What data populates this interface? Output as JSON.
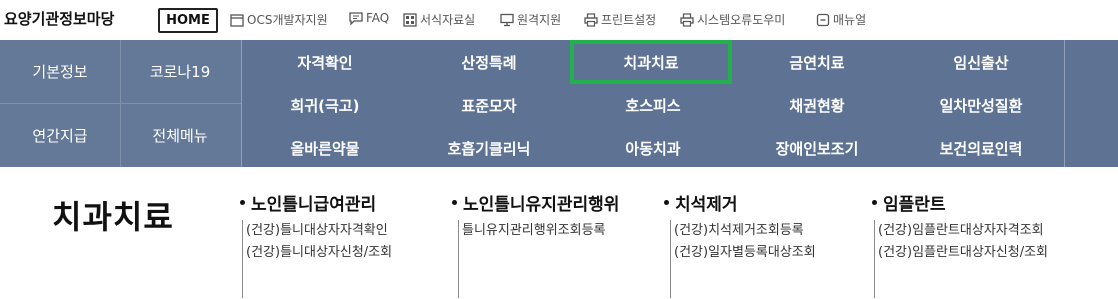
{
  "header": {
    "site_title": "요양기관정보마당",
    "home_label": "HOME",
    "utilities": [
      {
        "label": "OCS개발자지원",
        "icon": "calendar-icon"
      },
      {
        "label": "FAQ",
        "icon": "chat-icon"
      },
      {
        "label": "서식자료실",
        "icon": "form-icon"
      },
      {
        "label": "원격지원",
        "icon": "monitor-icon"
      },
      {
        "label": "프린트설정",
        "icon": "printer-icon"
      },
      {
        "label": "시스템오류도우미",
        "icon": "printer-icon"
      },
      {
        "label": "매뉴얼",
        "icon": "manual-icon"
      }
    ]
  },
  "nav": {
    "left": [
      "기본정보",
      "코로나19",
      "연간지급",
      "전체메뉴"
    ],
    "row1": [
      "자격확인",
      "산정특례",
      "치과치료",
      "금연치료",
      "임신출산"
    ],
    "row2": [
      "희귀(극고)",
      "표준모자",
      "호스피스",
      "채권현황",
      "일차만성질환"
    ],
    "row3": [
      "올바른약물",
      "호흡기클리닉",
      "아동치과",
      "장애인보조기",
      "보건의료인력"
    ],
    "active": "치과치료",
    "colors": {
      "band": "#5e7394",
      "left": "#647997",
      "active_border": "#22b14c"
    }
  },
  "content": {
    "title": "치과치료",
    "groups": [
      {
        "title": "노인틀니급여관리",
        "items": [
          "(건강)틀니대상자자격확인",
          "(건강)틀니대상자신청/조회"
        ]
      },
      {
        "title": "노인틀니유지관리행위",
        "items": [
          "틀니유지관리행위조회등록"
        ]
      },
      {
        "title": "치석제거",
        "items": [
          "(건강)치석제거조회등록",
          "(건강)일자별등록대상조회"
        ]
      },
      {
        "title": "임플란트",
        "items": [
          "(건강)임플란트대상자자격조회",
          "(건강)임플란트대상자신청/조회"
        ]
      }
    ]
  }
}
